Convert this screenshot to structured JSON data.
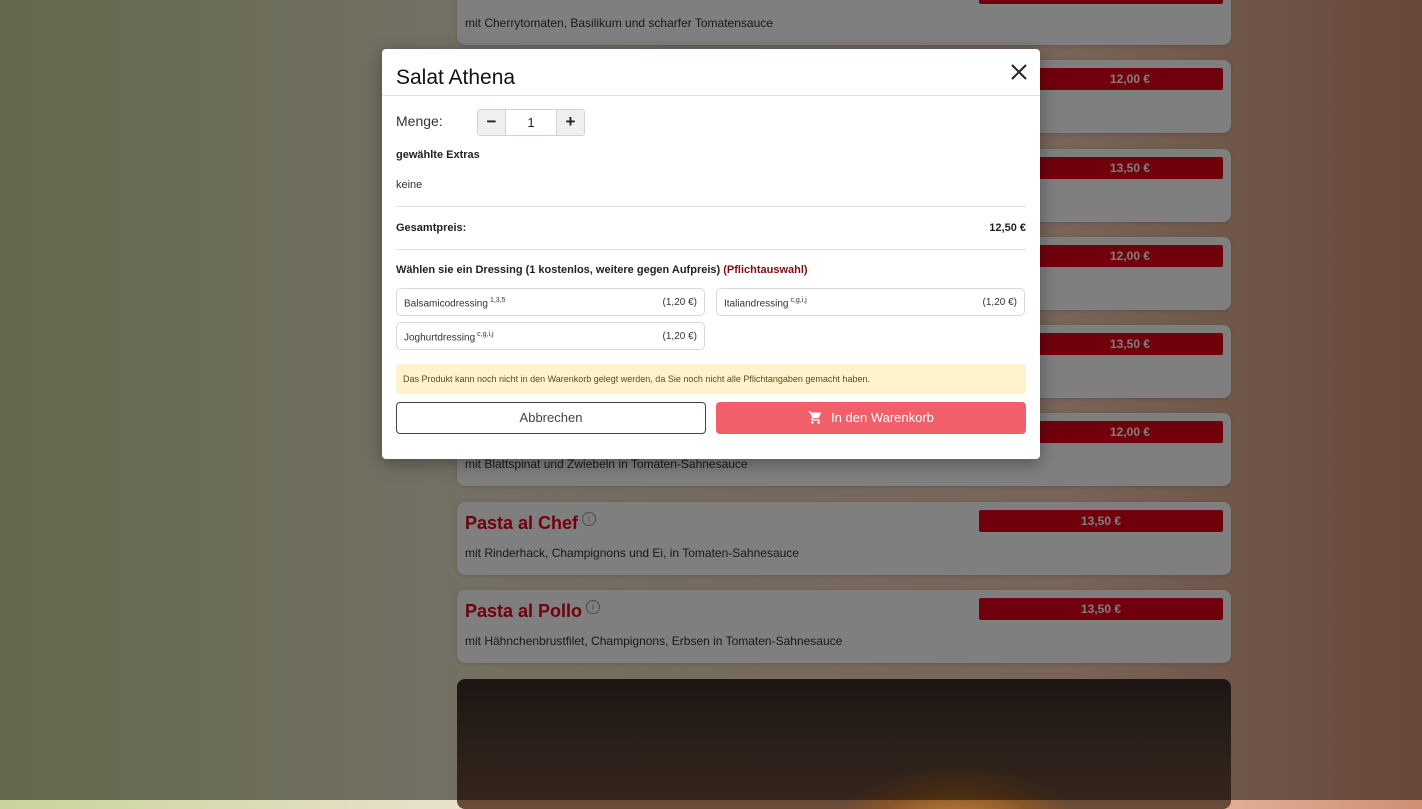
{
  "menu_items": [
    {
      "name": "",
      "desc": "mit Cherrytomaten, Basilikum und scharfer Tomatensauce",
      "price": ""
    },
    {
      "name": "",
      "desc": "",
      "price": "12,00 €"
    },
    {
      "name": "",
      "desc": "",
      "price": "13,50 €"
    },
    {
      "name": "",
      "desc": "",
      "price": "12,00 €"
    },
    {
      "name": "",
      "desc": "",
      "price": "13,50 €"
    },
    {
      "name": "",
      "desc": "mit Blattspinat und Zwiebeln in Tomaten-Sahnesauce",
      "price": "12,00 €"
    },
    {
      "name": "Pasta al Chef",
      "desc": "mit Rinderhack, Champignons und Ei, in Tomaten-Sahnesauce",
      "price": "13,50 €"
    },
    {
      "name": "Pasta al Pollo",
      "desc": "mit Hähnchenbrustfilet, Champignons, Erbsen in Tomaten-Sahnesauce",
      "price": "13,50 €"
    }
  ],
  "modal": {
    "title": "Salat Athena",
    "quantity_label": "Menge:",
    "quantity_value": "1",
    "minus": "−",
    "plus": "+",
    "extras_title": "gewählte Extras",
    "extras_value": "keine",
    "total_label": "Gesamtpreis:",
    "total_value": "12,50 €",
    "group_title": "Wählen sie ein Dressing (1 kostenlos, weitere gegen Aufpreis)",
    "group_required": "(Pflichtauswahl)",
    "options": [
      {
        "name": "Balsamicodressing",
        "sup": "1,3,5",
        "price": "(1,20 €)"
      },
      {
        "name": "Italiandressing",
        "sup": "c,g,i,j",
        "price": "(1,20 €)"
      },
      {
        "name": "Joghurtdressing",
        "sup": "c,g,i,j",
        "price": "(1,20 €)"
      }
    ],
    "alert": "Das Produkt kann noch nicht in den Warenkorb gelegt werden, da Sie noch nicht alle Pflichtangaben gemacht haben.",
    "cancel_label": "Abbrechen",
    "cart_label": "In den Warenkorb"
  },
  "colors": {
    "accent_red": "#e2001a",
    "cart_button": "#f05f6a",
    "alert_bg": "#fff3cd"
  },
  "icons": {
    "close": "close-icon",
    "cart": "cart-icon",
    "info": "info-icon"
  }
}
